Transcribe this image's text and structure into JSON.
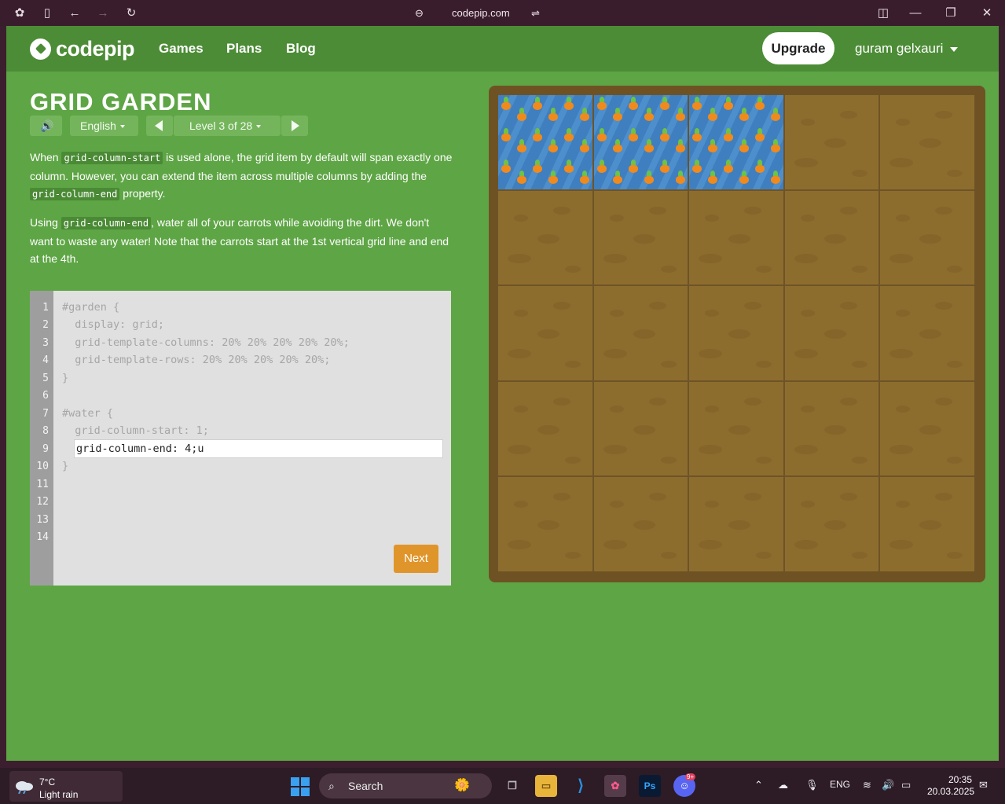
{
  "browser": {
    "url": "codepip.com"
  },
  "nav": {
    "logo": "codepip",
    "links": [
      "Games",
      "Plans",
      "Blog"
    ],
    "upgrade": "Upgrade",
    "user": "guram gelxauri"
  },
  "game": {
    "title": "GRID GARDEN",
    "language": "English",
    "level": "Level 3 of 28",
    "para1": {
      "t1": "When ",
      "c1": "grid-column-start",
      "t2": " is used alone, the grid item by default will span exactly one column. However, you can extend the item across multiple columns by adding the ",
      "c2": "grid-column-end",
      "t3": " property."
    },
    "para2": {
      "t1": "Using ",
      "c1": "grid-column-end",
      "t2": ", water all of your carrots while avoiding the dirt. We don't want to waste any water! Note that the carrots start at the 1st vertical grid line and end at the 4th."
    }
  },
  "editor": {
    "line_numbers": [
      "1",
      "2",
      "3",
      "4",
      "5",
      "6",
      "7",
      "8",
      "9",
      "10",
      "11",
      "12",
      "13",
      "14"
    ],
    "lines": [
      "#garden {",
      "  display: grid;",
      "  grid-template-columns: 20% 20% 20% 20% 20%;",
      "  grid-template-rows: 20% 20% 20% 20% 20%;",
      "}",
      "",
      "#water {",
      "  grid-column-start: 1;"
    ],
    "input_value": "grid-column-end: 4;u",
    "closing": "}",
    "next": "Next"
  },
  "garden": {
    "watered_columns": 3,
    "columns": 5,
    "rows": 5
  },
  "taskbar": {
    "temp": "7°C",
    "weather": "Light rain",
    "search": "Search",
    "lang": "ENG",
    "time": "20:35",
    "date": "20.03.2025",
    "badge": "9+"
  }
}
